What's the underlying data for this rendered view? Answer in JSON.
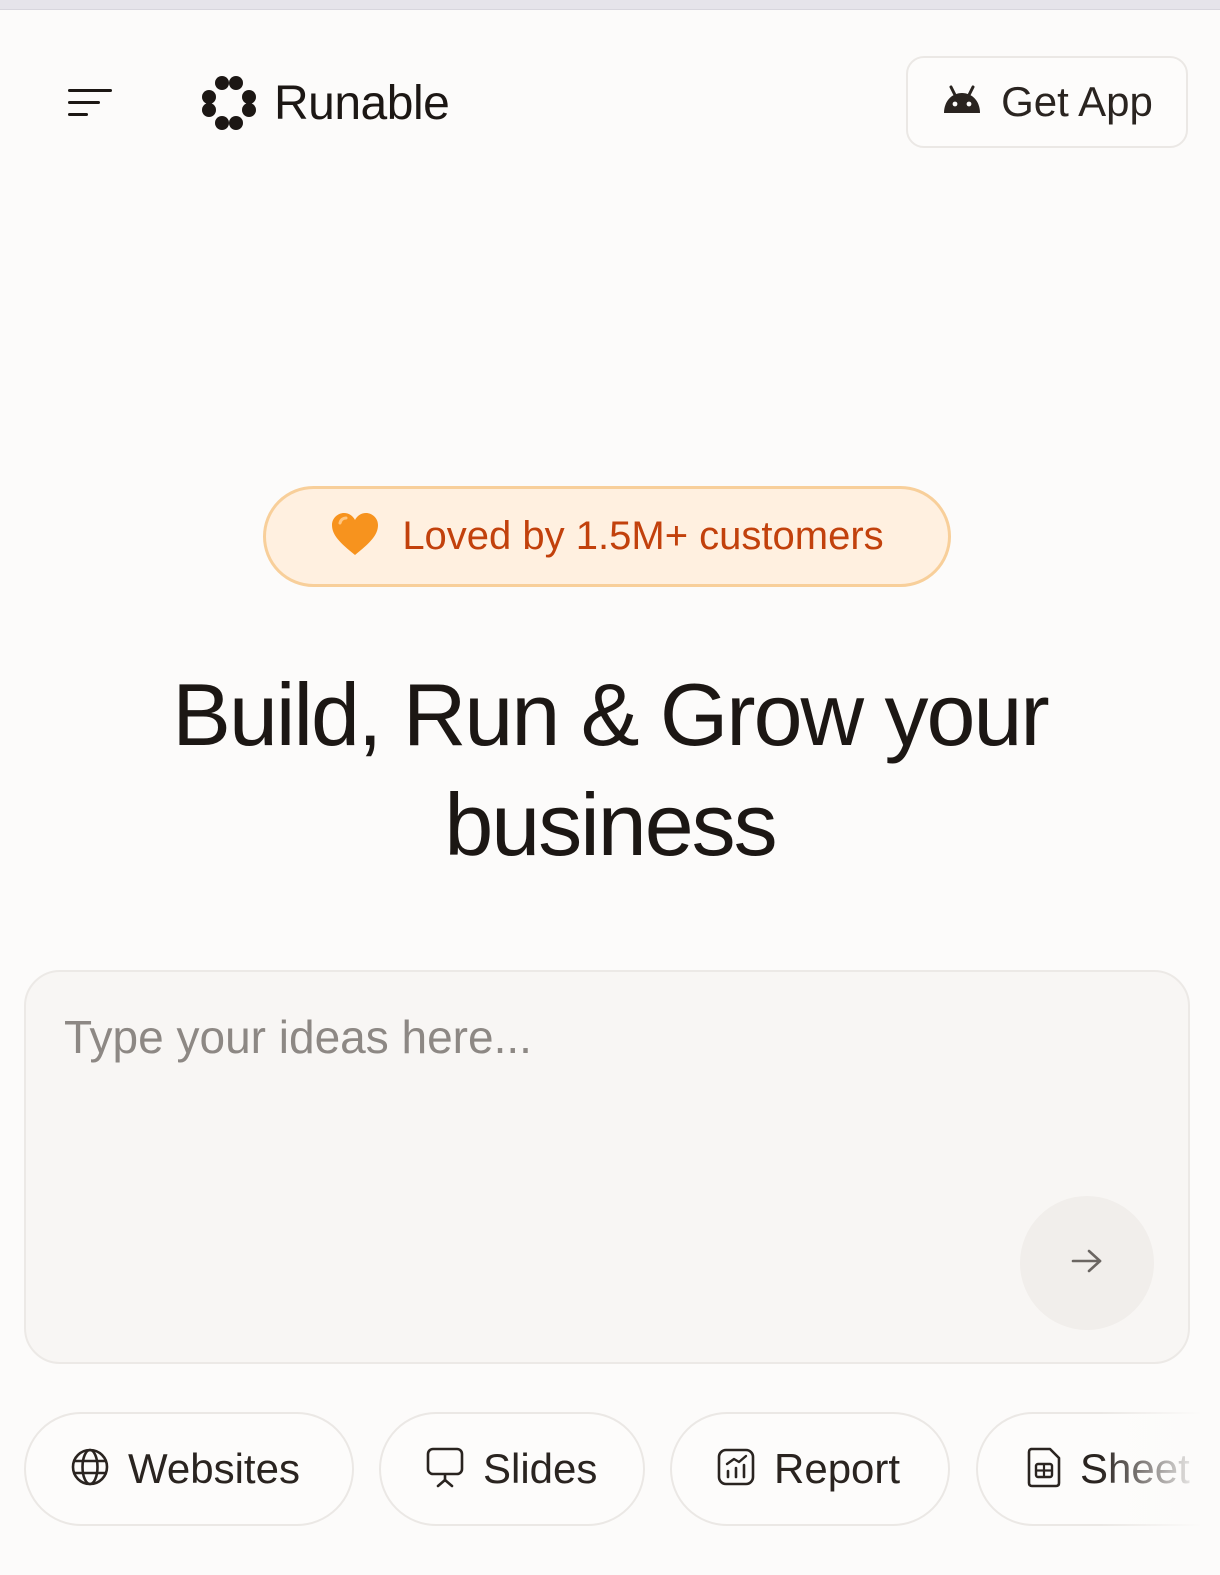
{
  "header": {
    "brand": "Runable",
    "get_app_label": "Get App",
    "menu_icon": "menu-icon",
    "android_icon": "android-icon"
  },
  "badge": {
    "text": "Loved by 1.5M+ customers",
    "emoji": "🧡",
    "color": "#c2410c",
    "background": "#fff0e0",
    "border": "#f8cf9a"
  },
  "hero": {
    "title_line1": "Build, Run & Grow your",
    "title_line2": "business"
  },
  "prompt": {
    "placeholder": "Type your ideas here...",
    "value": "",
    "send_icon": "arrow-right-icon"
  },
  "chips": [
    {
      "label": "Websites",
      "icon": "globe-icon"
    },
    {
      "label": "Slides",
      "icon": "presentation-icon"
    },
    {
      "label": "Report",
      "icon": "chart-report-icon"
    },
    {
      "label": "Sheet",
      "icon": "spreadsheet-icon"
    }
  ]
}
